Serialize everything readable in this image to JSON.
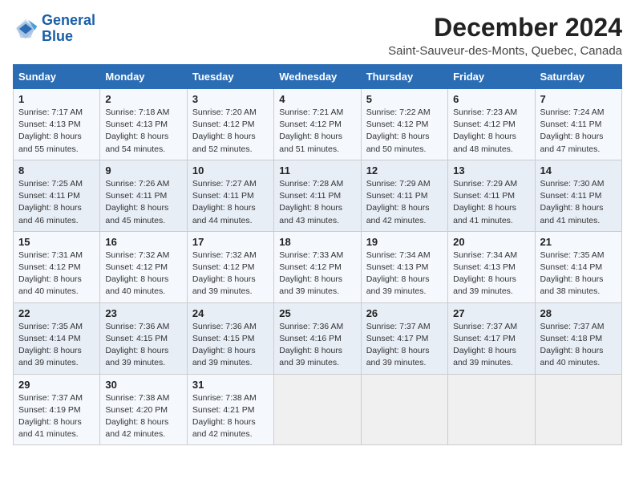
{
  "header": {
    "logo_line1": "General",
    "logo_line2": "Blue",
    "month_title": "December 2024",
    "location": "Saint-Sauveur-des-Monts, Quebec, Canada"
  },
  "days_of_week": [
    "Sunday",
    "Monday",
    "Tuesday",
    "Wednesday",
    "Thursday",
    "Friday",
    "Saturday"
  ],
  "weeks": [
    [
      {
        "day": "1",
        "sunrise": "7:17 AM",
        "sunset": "4:13 PM",
        "daylight": "8 hours and 55 minutes."
      },
      {
        "day": "2",
        "sunrise": "7:18 AM",
        "sunset": "4:13 PM",
        "daylight": "8 hours and 54 minutes."
      },
      {
        "day": "3",
        "sunrise": "7:20 AM",
        "sunset": "4:12 PM",
        "daylight": "8 hours and 52 minutes."
      },
      {
        "day": "4",
        "sunrise": "7:21 AM",
        "sunset": "4:12 PM",
        "daylight": "8 hours and 51 minutes."
      },
      {
        "day": "5",
        "sunrise": "7:22 AM",
        "sunset": "4:12 PM",
        "daylight": "8 hours and 50 minutes."
      },
      {
        "day": "6",
        "sunrise": "7:23 AM",
        "sunset": "4:12 PM",
        "daylight": "8 hours and 48 minutes."
      },
      {
        "day": "7",
        "sunrise": "7:24 AM",
        "sunset": "4:11 PM",
        "daylight": "8 hours and 47 minutes."
      }
    ],
    [
      {
        "day": "8",
        "sunrise": "7:25 AM",
        "sunset": "4:11 PM",
        "daylight": "8 hours and 46 minutes."
      },
      {
        "day": "9",
        "sunrise": "7:26 AM",
        "sunset": "4:11 PM",
        "daylight": "8 hours and 45 minutes."
      },
      {
        "day": "10",
        "sunrise": "7:27 AM",
        "sunset": "4:11 PM",
        "daylight": "8 hours and 44 minutes."
      },
      {
        "day": "11",
        "sunrise": "7:28 AM",
        "sunset": "4:11 PM",
        "daylight": "8 hours and 43 minutes."
      },
      {
        "day": "12",
        "sunrise": "7:29 AM",
        "sunset": "4:11 PM",
        "daylight": "8 hours and 42 minutes."
      },
      {
        "day": "13",
        "sunrise": "7:29 AM",
        "sunset": "4:11 PM",
        "daylight": "8 hours and 41 minutes."
      },
      {
        "day": "14",
        "sunrise": "7:30 AM",
        "sunset": "4:11 PM",
        "daylight": "8 hours and 41 minutes."
      }
    ],
    [
      {
        "day": "15",
        "sunrise": "7:31 AM",
        "sunset": "4:12 PM",
        "daylight": "8 hours and 40 minutes."
      },
      {
        "day": "16",
        "sunrise": "7:32 AM",
        "sunset": "4:12 PM",
        "daylight": "8 hours and 40 minutes."
      },
      {
        "day": "17",
        "sunrise": "7:32 AM",
        "sunset": "4:12 PM",
        "daylight": "8 hours and 39 minutes."
      },
      {
        "day": "18",
        "sunrise": "7:33 AM",
        "sunset": "4:12 PM",
        "daylight": "8 hours and 39 minutes."
      },
      {
        "day": "19",
        "sunrise": "7:34 AM",
        "sunset": "4:13 PM",
        "daylight": "8 hours and 39 minutes."
      },
      {
        "day": "20",
        "sunrise": "7:34 AM",
        "sunset": "4:13 PM",
        "daylight": "8 hours and 39 minutes."
      },
      {
        "day": "21",
        "sunrise": "7:35 AM",
        "sunset": "4:14 PM",
        "daylight": "8 hours and 38 minutes."
      }
    ],
    [
      {
        "day": "22",
        "sunrise": "7:35 AM",
        "sunset": "4:14 PM",
        "daylight": "8 hours and 39 minutes."
      },
      {
        "day": "23",
        "sunrise": "7:36 AM",
        "sunset": "4:15 PM",
        "daylight": "8 hours and 39 minutes."
      },
      {
        "day": "24",
        "sunrise": "7:36 AM",
        "sunset": "4:15 PM",
        "daylight": "8 hours and 39 minutes."
      },
      {
        "day": "25",
        "sunrise": "7:36 AM",
        "sunset": "4:16 PM",
        "daylight": "8 hours and 39 minutes."
      },
      {
        "day": "26",
        "sunrise": "7:37 AM",
        "sunset": "4:17 PM",
        "daylight": "8 hours and 39 minutes."
      },
      {
        "day": "27",
        "sunrise": "7:37 AM",
        "sunset": "4:17 PM",
        "daylight": "8 hours and 39 minutes."
      },
      {
        "day": "28",
        "sunrise": "7:37 AM",
        "sunset": "4:18 PM",
        "daylight": "8 hours and 40 minutes."
      }
    ],
    [
      {
        "day": "29",
        "sunrise": "7:37 AM",
        "sunset": "4:19 PM",
        "daylight": "8 hours and 41 minutes."
      },
      {
        "day": "30",
        "sunrise": "7:38 AM",
        "sunset": "4:20 PM",
        "daylight": "8 hours and 42 minutes."
      },
      {
        "day": "31",
        "sunrise": "7:38 AM",
        "sunset": "4:21 PM",
        "daylight": "8 hours and 42 minutes."
      },
      null,
      null,
      null,
      null
    ]
  ]
}
